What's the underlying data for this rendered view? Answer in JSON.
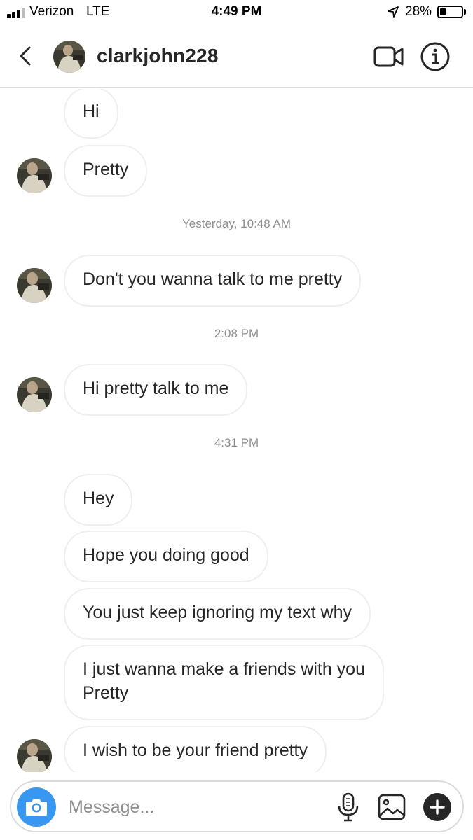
{
  "status_bar": {
    "carrier": "Verizon",
    "network": "LTE",
    "time": "4:49 PM",
    "battery": "28%",
    "battery_level": 0.28
  },
  "header": {
    "username": "clarkjohn228",
    "icons": [
      "back-icon",
      "avatar",
      "video-call-icon",
      "info-icon"
    ]
  },
  "thread": {
    "messages": [
      {
        "type": "bubble",
        "text": "Hi"
      },
      {
        "type": "bubble",
        "text": "Pretty"
      },
      {
        "type": "timestamp",
        "text": "Yesterday, 10:48 AM"
      },
      {
        "type": "bubble",
        "text": "Don't you wanna talk to me pretty"
      },
      {
        "type": "timestamp",
        "text": "2:08 PM"
      },
      {
        "type": "bubble",
        "text": "Hi pretty talk to me"
      },
      {
        "type": "timestamp",
        "text": "4:31 PM"
      },
      {
        "type": "bubble",
        "text": "Hey"
      },
      {
        "type": "bubble",
        "text": "Hope you doing good"
      },
      {
        "type": "bubble",
        "text": "You just keep ignoring my text why"
      },
      {
        "type": "bubble",
        "text": "I just wanna make a friends with you\nPretty"
      },
      {
        "type": "bubble",
        "text": "I wish to be your friend pretty"
      }
    ]
  },
  "composer": {
    "placeholder": "Message...",
    "icons": [
      "camera-icon",
      "microphone-icon",
      "gallery-icon",
      "plus-icon"
    ]
  },
  "colors": {
    "camera_button": "#3897f0",
    "bubble_border": "#efefef",
    "timestamp_text": "#8e8e8e",
    "text": "#262626"
  }
}
